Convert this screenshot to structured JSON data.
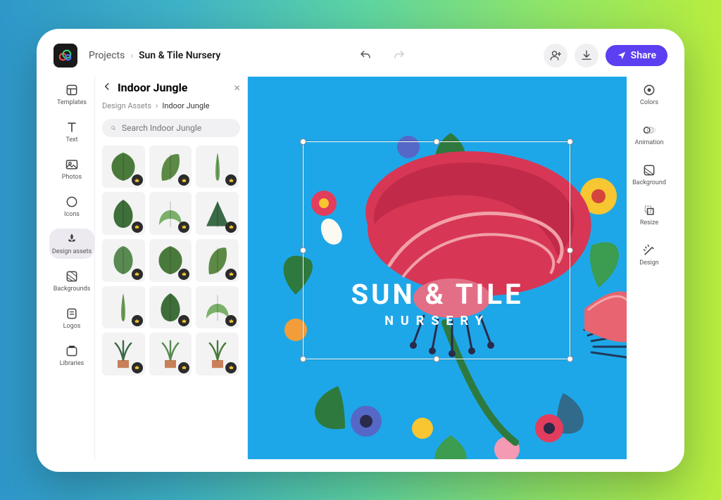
{
  "breadcrumb": {
    "root": "Projects",
    "current": "Sun & Tile Nursery"
  },
  "topbar": {
    "share_label": "Share"
  },
  "left_rail": {
    "items": [
      {
        "label": "Templates"
      },
      {
        "label": "Text"
      },
      {
        "label": "Photos"
      },
      {
        "label": "Icons"
      },
      {
        "label": "Design assets"
      },
      {
        "label": "Backgrounds"
      },
      {
        "label": "Logos"
      },
      {
        "label": "Libraries"
      }
    ]
  },
  "asset_panel": {
    "title": "Indoor Jungle",
    "bc_root": "Design Assets",
    "bc_current": "Indoor Jungle",
    "search_placeholder": "Search Indoor Jungle"
  },
  "right_rail": {
    "items": [
      {
        "label": "Colors"
      },
      {
        "label": "Animation"
      },
      {
        "label": "Background"
      },
      {
        "label": "Resize"
      },
      {
        "label": "Design"
      }
    ]
  },
  "canvas": {
    "title_line1": "SUN & TILE",
    "title_line2": "NURSERY"
  }
}
